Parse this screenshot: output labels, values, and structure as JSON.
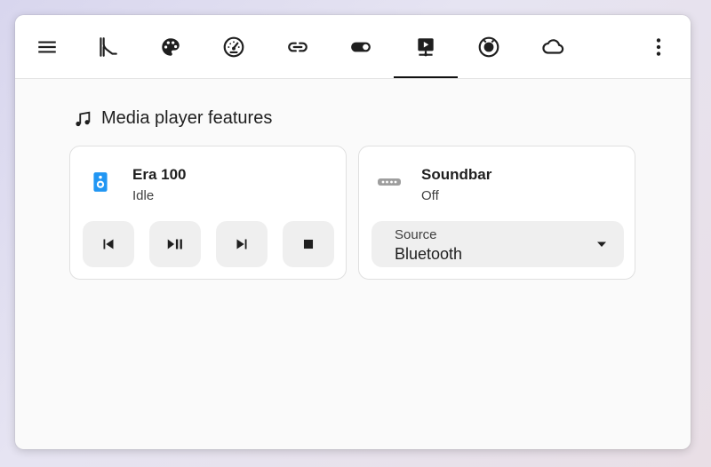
{
  "toolbar": {
    "tabs": [
      {
        "icon": "menu-icon"
      },
      {
        "icon": "slide-icon"
      },
      {
        "icon": "palette-icon"
      },
      {
        "icon": "gauge-icon"
      },
      {
        "icon": "link-icon"
      },
      {
        "icon": "toggle-switch-icon"
      },
      {
        "icon": "media-player-icon",
        "selected": true
      },
      {
        "icon": "robot-vacuum-icon"
      },
      {
        "icon": "cloud-icon"
      },
      {
        "icon": "more-vertical-icon"
      }
    ]
  },
  "section": {
    "title": "Media player features",
    "icon": "music-note-icon"
  },
  "cards": {
    "era": {
      "name": "Era 100",
      "state": "Idle",
      "icon": "speaker-icon",
      "icon_color": "#2196f3",
      "controls": [
        "previous-track",
        "play-pause",
        "next-track",
        "stop"
      ]
    },
    "soundbar": {
      "name": "Soundbar",
      "state": "Off",
      "icon": "soundbar-icon",
      "icon_color": "#9e9e9e",
      "source_label": "Source",
      "source_value": "Bluetooth"
    }
  }
}
